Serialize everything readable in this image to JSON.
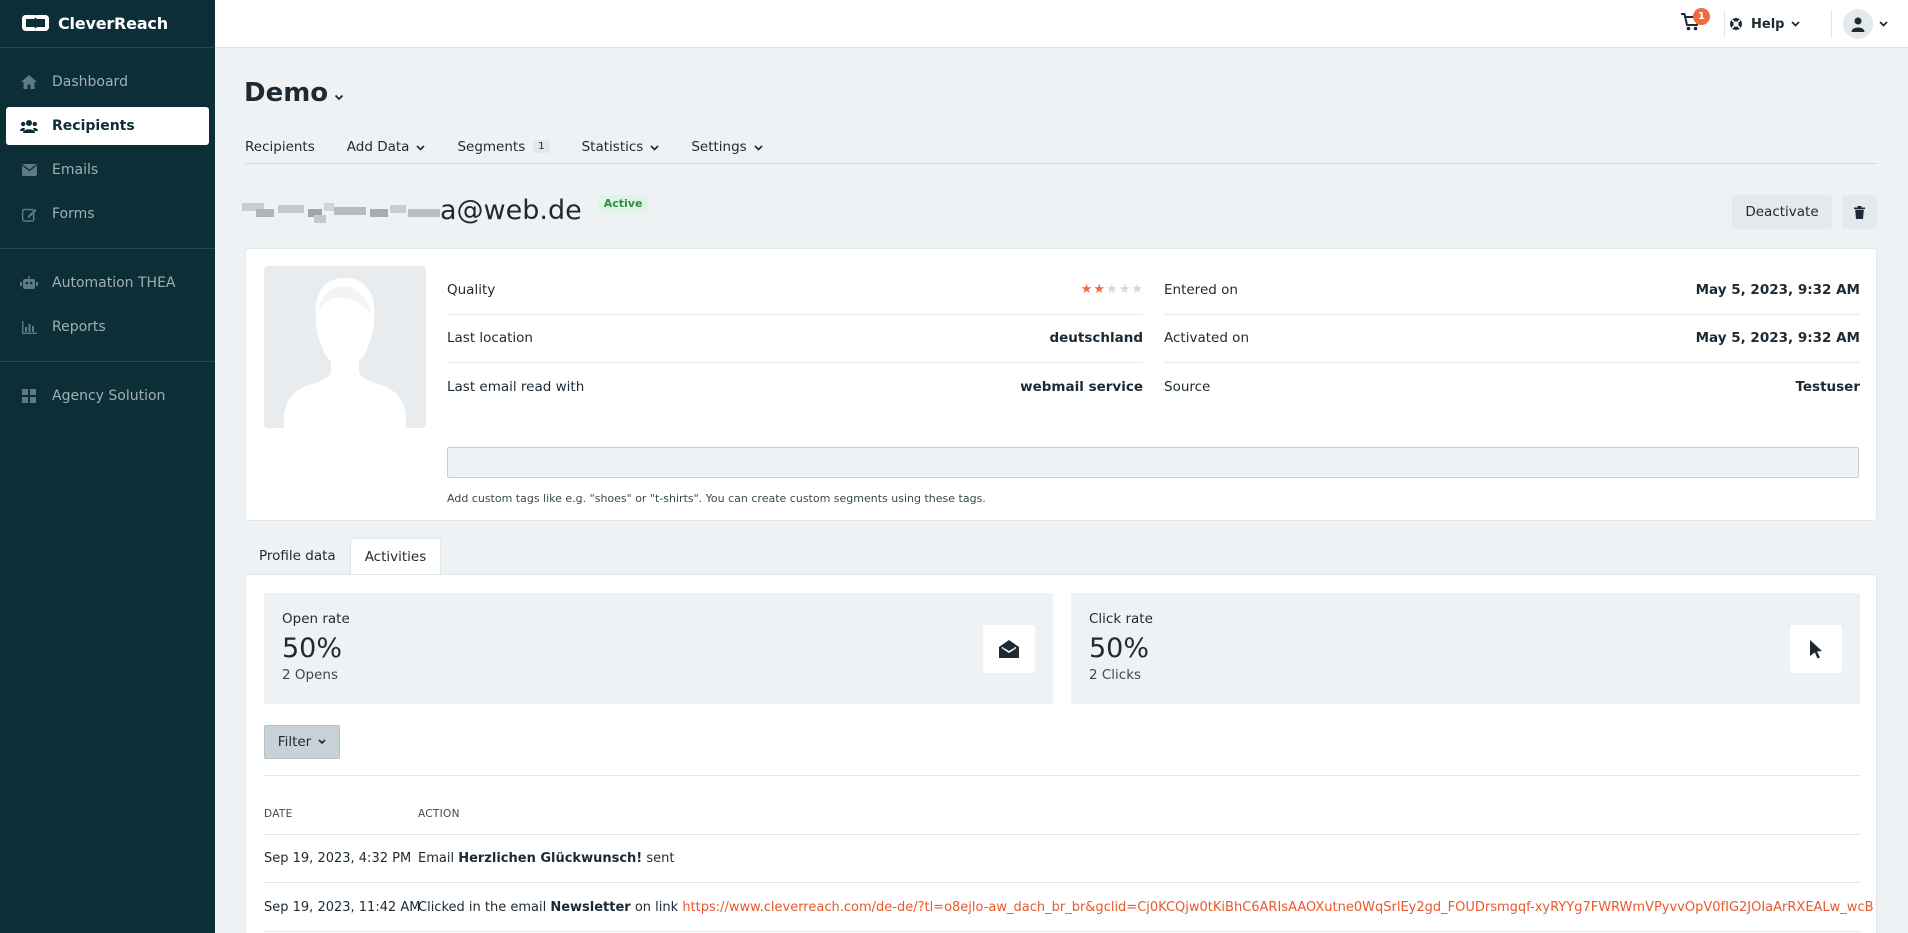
{
  "app": {
    "logo_text": "CleverReach"
  },
  "sidebar": {
    "groups": [
      [
        {
          "label": "Dashboard",
          "icon": "home-icon"
        },
        {
          "label": "Recipients",
          "icon": "users-icon",
          "active": true
        },
        {
          "label": "Emails",
          "icon": "envelope-icon"
        },
        {
          "label": "Forms",
          "icon": "edit-icon"
        }
      ],
      [
        {
          "label": "Automation THEA",
          "icon": "robot-icon"
        },
        {
          "label": "Reports",
          "icon": "chart-icon"
        }
      ],
      [
        {
          "label": "Agency Solution",
          "icon": "grid-icon"
        }
      ]
    ]
  },
  "topbar": {
    "cart_count": "1",
    "help_label": "Help"
  },
  "page": {
    "title": "Demo",
    "tabs": [
      {
        "label": "Recipients"
      },
      {
        "label": "Add Data",
        "dropdown": true
      },
      {
        "label": "Segments",
        "count": "1"
      },
      {
        "label": "Statistics",
        "dropdown": true
      },
      {
        "label": "Settings",
        "dropdown": true
      }
    ]
  },
  "recipient": {
    "email_visible": "a@web.de",
    "status": "Active",
    "deactivate_label": "Deactivate",
    "quality_label": "Quality",
    "quality_stars": 2,
    "quality_max": 5,
    "left_info": [
      {
        "label": "Last location",
        "value": "deutschland"
      },
      {
        "label": "Last email read with",
        "value": "webmail service"
      }
    ],
    "right_info": [
      {
        "label": "Entered on",
        "value": "May 5, 2023, 9:32 AM"
      },
      {
        "label": "Activated on",
        "value": "May 5, 2023, 9:32 AM"
      },
      {
        "label": "Source",
        "value": "Testuser"
      }
    ],
    "tags_placeholder": "",
    "tags_hint": "Add custom tags like e.g. \"shoes\" or \"t-shirts\". You can create custom segments using these tags."
  },
  "detail_tabs": [
    {
      "label": "Profile data"
    },
    {
      "label": "Activities",
      "active": true
    }
  ],
  "activities": {
    "open": {
      "title": "Open rate",
      "value": "50%",
      "sub": "2 Opens"
    },
    "click": {
      "title": "Click rate",
      "value": "50%",
      "sub": "2 Clicks"
    },
    "filter_label": "Filter",
    "headers": {
      "date": "DATE",
      "action": "ACTION"
    },
    "rows": [
      {
        "date": "Sep 19, 2023, 4:32 PM",
        "pre": "Email ",
        "bold": "Herzlichen Glückwunsch!",
        "post": " sent",
        "link": ""
      },
      {
        "date": "Sep 19, 2023, 11:42 AM",
        "pre": "Clicked in the email ",
        "bold": "Newsletter",
        "post": " on link ",
        "link": "https://www.cleverreach.com/de-de/?tl=o8ejlo-aw_dach_br_br&gclid=Cj0KCQjw0tKiBhC6ARIsAAOXutne0WqSrlEy2gd_FOUDrsmgqf-xyRYYg7FWRWmVPyvvOpV0fIG2JOIaArRXEALw_wcB"
      }
    ]
  },
  "colors": {
    "sidebar": "#0c2e36",
    "accent": "#f06a3f",
    "link": "#e8592b",
    "active_badge": "#2e8c4a"
  }
}
